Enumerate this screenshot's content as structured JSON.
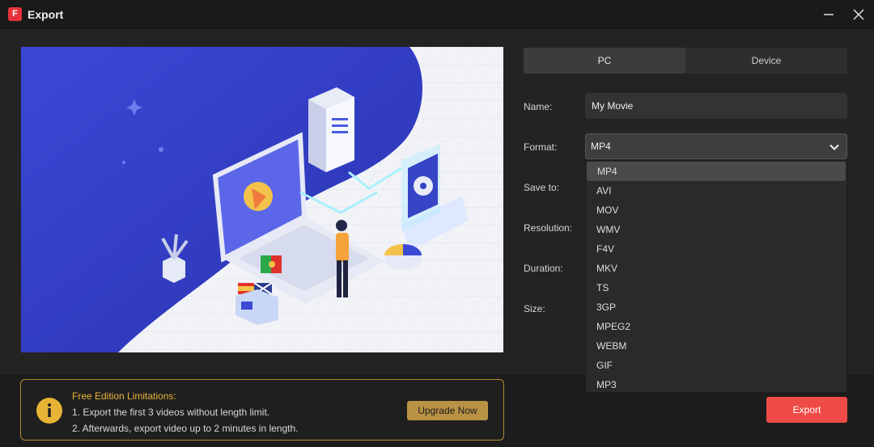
{
  "window": {
    "title": "Export",
    "logo_text": "F"
  },
  "tabs": [
    {
      "label": "PC",
      "active": true
    },
    {
      "label": "Device",
      "active": false
    }
  ],
  "form": {
    "name_label": "Name:",
    "name_value": "My Movie",
    "format_label": "Format:",
    "format_value": "MP4",
    "save_label": "Save to:",
    "resolution_label": "Resolution:",
    "duration_label": "Duration:",
    "size_label": "Size:"
  },
  "format_options": [
    "MP4",
    "AVI",
    "MOV",
    "WMV",
    "F4V",
    "MKV",
    "TS",
    "3GP",
    "MPEG2",
    "WEBM",
    "GIF",
    "MP3"
  ],
  "limitations": {
    "title": "Free Edition Limitations:",
    "line1": "1. Export the first 3 videos without length limit.",
    "line2": "2. Afterwards, export video up to 2 minutes in length.",
    "upgrade_label": "Upgrade Now"
  },
  "export_label": "Export",
  "colors": {
    "accent_red": "#ee4b46",
    "upgrade_gold": "#b99245",
    "notice_title": "#e8b437",
    "illustration_blue": "#3540c8"
  }
}
